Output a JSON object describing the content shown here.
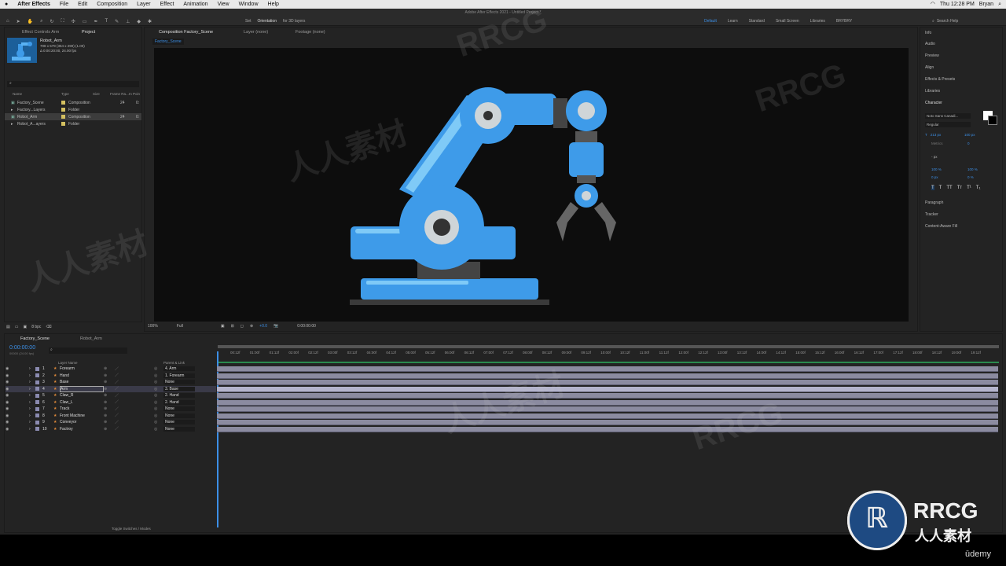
{
  "menubar": {
    "app": "After Effects",
    "items": [
      "File",
      "Edit",
      "Composition",
      "Layer",
      "Effect",
      "Animation",
      "View",
      "Window",
      "Help"
    ],
    "title": "Adobe After Effects 2021 - Untitled Project *",
    "clock": "Thu 12:28 PM",
    "user": "Bryan"
  },
  "toolbar": {
    "set": "Set",
    "orientation": "Orientation",
    "for3d": "for 3D layers",
    "workspaces": [
      "Default",
      "Learn",
      "Standard",
      "Small Screen",
      "Libraries",
      "BRYBRY"
    ],
    "search": "Search Help"
  },
  "project": {
    "tab1": "Effect Controls Arm",
    "tab2": "Project",
    "asset_name": "Robot_Arm",
    "asset_info1": "708 x 579 (354 x 290) (1.00)",
    "asset_info2": "Δ 0:00:20:00, 24.00 fps",
    "cols": [
      "Name",
      "Type",
      "Size",
      "Frame Ra...",
      "In Poin"
    ],
    "items": [
      {
        "name": "Factory_Scene",
        "type": "Composition",
        "fr": "24",
        "ip": "0:"
      },
      {
        "name": "Factory...Layers",
        "type": "Folder",
        "fr": "",
        "ip": ""
      },
      {
        "name": "Robot_Arm",
        "type": "Composition",
        "fr": "24",
        "ip": "0:"
      },
      {
        "name": "Robot_A...ayers",
        "type": "Folder",
        "fr": "",
        "ip": ""
      }
    ],
    "bpc": "8 bpc"
  },
  "comp": {
    "tab": "Composition Factory_Scene",
    "layer": "Layer (none)",
    "footage": "Footage (none)",
    "breadcrumb": "Factory_Scene",
    "zoom": "100%",
    "quality": "Full",
    "exposure": "+0.0",
    "timecode": "0:00:00:00"
  },
  "right": {
    "items": [
      "Info",
      "Audio",
      "Preview",
      "Align",
      "Effects & Presets",
      "Libraries",
      "Character"
    ],
    "font": "Noto Sans Canadi...",
    "style": "Regular",
    "size": "213 px",
    "leading": "100 px",
    "tracking": "0",
    "kern": "Metrics",
    "stroke": "- px",
    "vscale": "100 %",
    "hscale": "100 %",
    "baseline": "0 px",
    "tsume": "0 %",
    "lower": [
      "Paragraph",
      "Tracker",
      "Content-Aware Fill"
    ]
  },
  "timeline": {
    "tab1": "Factory_Scene",
    "tab2": "Robot_Arm",
    "time": "0:00:00:00",
    "fps": "00000 (24.00 fps)",
    "col_layer": "Layer Name",
    "col_parent": "Parent & Link",
    "footer": "Toggle Switches / Modes",
    "ruler": [
      "00:12f",
      "01:00f",
      "01:12f",
      "02:00f",
      "02:12f",
      "03:00f",
      "03:12f",
      "04:00f",
      "04:12f",
      "05:00f",
      "05:12f",
      "06:00f",
      "06:12f",
      "07:00f",
      "07:12f",
      "08:00f",
      "08:12f",
      "09:00f",
      "09:12f",
      "10:00f",
      "10:12f",
      "11:00f",
      "11:12f",
      "12:00f",
      "12:12f",
      "13:00f",
      "13:12f",
      "14:00f",
      "14:12f",
      "15:00f",
      "15:12f",
      "16:00f",
      "16:12f",
      "17:00f",
      "17:12f",
      "18:00f",
      "18:12f",
      "19:00f",
      "19:12f"
    ],
    "layers": [
      {
        "num": "1",
        "name": "Forearm",
        "parent": "4. Arm"
      },
      {
        "num": "2",
        "name": "Hand",
        "parent": "1. Forearm"
      },
      {
        "num": "3",
        "name": "Base",
        "parent": "None"
      },
      {
        "num": "4",
        "name": "Arm",
        "parent": "3. Base"
      },
      {
        "num": "5",
        "name": "Claw_R",
        "parent": "2. Hand"
      },
      {
        "num": "6",
        "name": "Claw_L",
        "parent": "2. Hand"
      },
      {
        "num": "7",
        "name": "Track",
        "parent": "None"
      },
      {
        "num": "8",
        "name": "Front Machine",
        "parent": "None"
      },
      {
        "num": "9",
        "name": "Conveyor",
        "parent": "None"
      },
      {
        "num": "10",
        "name": "Factroy",
        "parent": "None"
      }
    ]
  },
  "watermark": {
    "text1": "RRCG",
    "text2": "人人素材",
    "logo1": "RRCG",
    "logo2": "人人素材",
    "udemy": "ūdemy"
  },
  "colors": {
    "accent": "#3c8fe6",
    "robot": "#3e9be9",
    "robot_light": "#6fc2f7",
    "bg": "#232323",
    "canvas": "#0d0d0d"
  }
}
